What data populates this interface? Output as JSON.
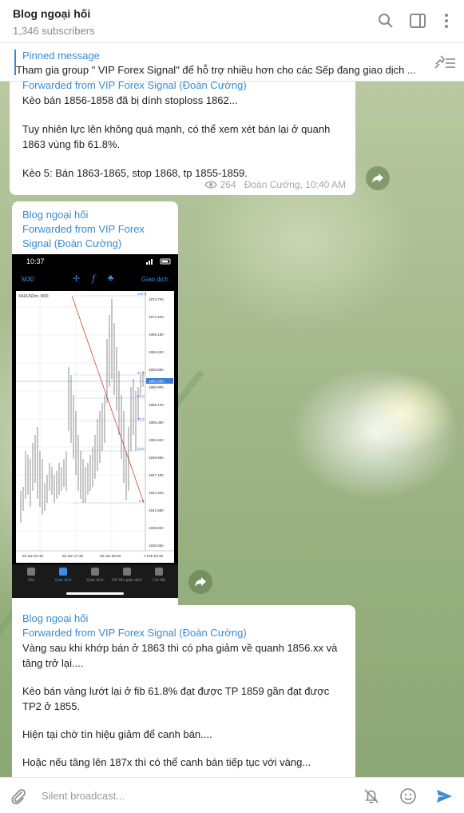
{
  "header": {
    "title": "Blog ngoại hối",
    "subtitle": "1,346 subscribers",
    "icons": [
      "search-icon",
      "sidebar-toggle-icon",
      "more-icon"
    ]
  },
  "pinned": {
    "label": "Pinned message",
    "text": "Tham gia group \" VIP Forex Signal\" để hỗ trợ nhiều hơn cho các Sếp đang giao dịch ..."
  },
  "messages": [
    {
      "forwarded": "Forwarded from VIP Forex Signal (Đoàn Cường)",
      "lines": [
        "Kèo bán 1856-1858 đã bị dính stoploss 1862...",
        "Tuy nhiên lực lên không quá mạnh, có thể xem xét bán lại ở quanh",
        "1863 vùng fib 61.8%.",
        "Kèo 5: Bán 1863-1865, stop 1868, tp 1855-1859."
      ],
      "views": "264",
      "author_time": "Đoàn Cường, 10:40 AM"
    },
    {
      "channel": "Blog ngoại hối",
      "forwarded_line1": "Forwarded from VIP Forex",
      "forwarded_line2": "Signal (Đoàn Cường)",
      "screenshot": {
        "time": "10:37",
        "symbol_tf": "M30",
        "trade_label": "Giao dịch",
        "chart_title": "XAUUSDm, M30",
        "prices": [
          "1874.700",
          "1871.940",
          "1869.180",
          "1866.420",
          "1863.660",
          "1860.900",
          "1858.140",
          "1855.380",
          "1852.620",
          "1849.860",
          "1847.100",
          "1844.340",
          "1841.580",
          "1838.820",
          "1836.060"
        ],
        "current_price": "1861.830",
        "fib_levels": [
          "100.0",
          "61.8",
          "50.0",
          "38.2",
          "23.6",
          "0.0"
        ],
        "dates": [
          "28 Jan 01:30",
          "28 Jan 17:30",
          "29 Jan 09:30",
          "1 Feb 03:30"
        ],
        "tabs": [
          "Giá",
          "Giao dịch",
          "Giao dịch",
          "Dữ liệu giao dịch",
          "Cài đặt"
        ]
      }
    },
    {
      "channel": "Blog ngoại hối",
      "forwarded": "Forwarded from VIP Forex Signal (Đoàn Cường)",
      "lines": [
        "Vàng sau khi khớp bán ở 1863 thì có pha giảm về quanh 1856.xx và",
        "tăng trở lại....",
        "Kèo bán vàng lướt lại ở fib 61.8% đạt được TP 1859 gần đạt được",
        "TP2 ở 1855.",
        "Hiện tại chờ tín hiệu giảm để canh bán....",
        "Hoặc nếu tăng lên 187x thì có thể canh bán tiếp tục với vàng..."
      ]
    }
  ],
  "composer": {
    "placeholder": "Silent broadcast..."
  },
  "colors": {
    "accent": "#3a8bd0",
    "send": "#3a8bd0"
  }
}
